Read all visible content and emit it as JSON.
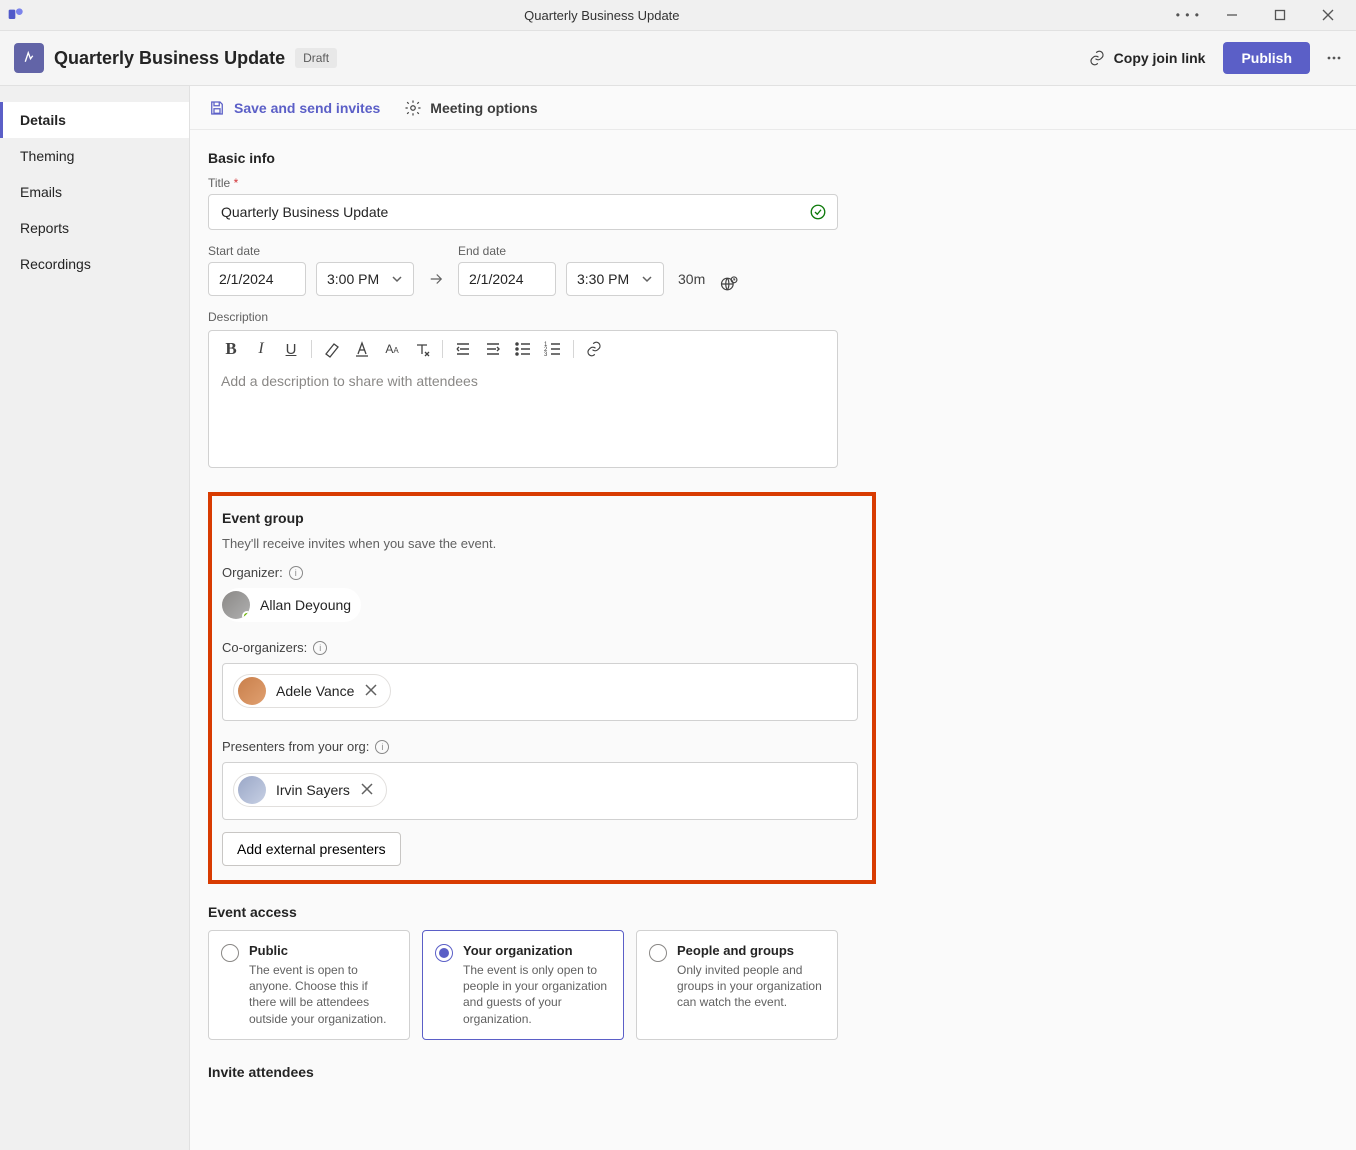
{
  "titlebar": {
    "title": "Quarterly Business Update"
  },
  "header": {
    "event_title": "Quarterly Business Update",
    "draft_label": "Draft",
    "copy_link_label": "Copy join link",
    "publish_label": "Publish"
  },
  "sidebar": {
    "items": [
      {
        "label": "Details"
      },
      {
        "label": "Theming"
      },
      {
        "label": "Emails"
      },
      {
        "label": "Reports"
      },
      {
        "label": "Recordings"
      }
    ]
  },
  "toolbar": {
    "save_label": "Save and send invites",
    "options_label": "Meeting options"
  },
  "basic_info": {
    "heading": "Basic info",
    "title_label": "Title",
    "title_value": "Quarterly Business Update",
    "start_label": "Start date",
    "end_label": "End date",
    "start_date": "2/1/2024",
    "start_time": "3:00 PM",
    "end_date": "2/1/2024",
    "end_time": "3:30 PM",
    "duration": "30m",
    "desc_label": "Description",
    "desc_placeholder": "Add a description to share with attendees"
  },
  "event_group": {
    "heading": "Event group",
    "sub": "They'll receive invites when you save the event.",
    "organizer_label": "Organizer:",
    "organizer_name": "Allan Deyoung",
    "co_label": "Co-organizers:",
    "co_name": "Adele Vance",
    "presenters_label": "Presenters from your org:",
    "presenter_name": "Irvin Sayers",
    "add_external_label": "Add external presenters"
  },
  "event_access": {
    "heading": "Event access",
    "options": [
      {
        "title": "Public",
        "desc": "The event is open to anyone. Choose this if there will be attendees outside your organization."
      },
      {
        "title": "Your organization",
        "desc": "The event is only open to people in your organization and guests of your organization."
      },
      {
        "title": "People and groups",
        "desc": "Only invited people and groups in your organization can watch the event."
      }
    ]
  },
  "invite": {
    "heading": "Invite attendees"
  }
}
